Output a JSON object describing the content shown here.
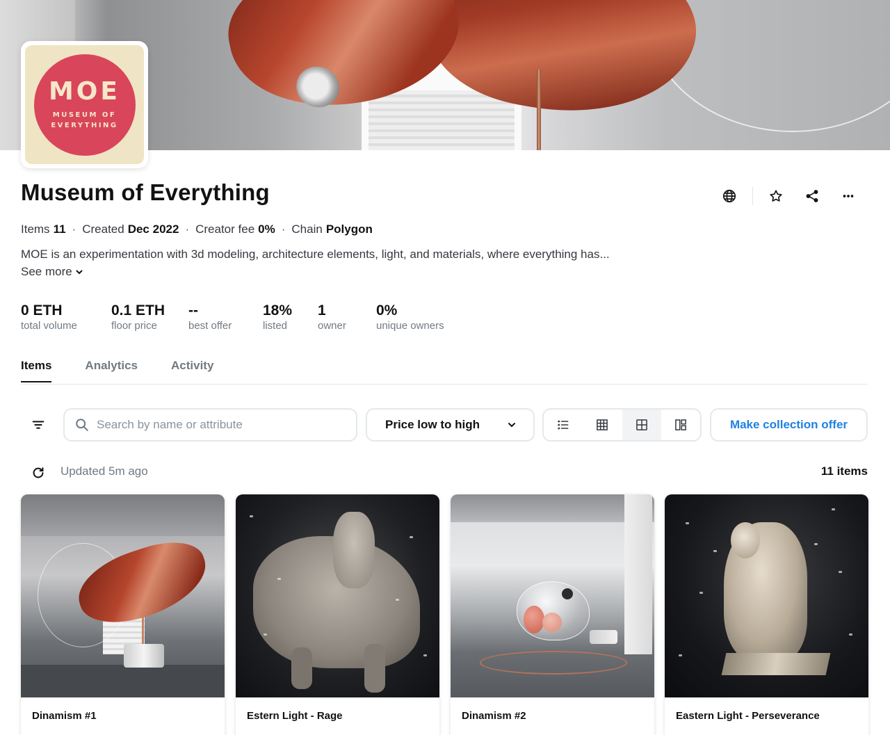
{
  "collection": {
    "logo": {
      "big": "MOE",
      "line1": "MUSEUM OF",
      "line2": "EVERYTHING"
    },
    "title": "Museum of Everything",
    "meta": {
      "items_label": "Items",
      "items_value": "11",
      "created_label": "Created",
      "created_value": "Dec 2022",
      "fee_label": "Creator fee",
      "fee_value": "0%",
      "chain_label": "Chain",
      "chain_value": "Polygon",
      "separator": "·"
    },
    "description": "MOE is an experimentation with 3d modeling, architecture elements, light, and materials, where everything has...",
    "see_more": "See more"
  },
  "actions": {
    "icons": [
      "globe-icon",
      "star-icon",
      "share-icon",
      "more-icon"
    ]
  },
  "stats": [
    {
      "value": "0 ETH",
      "label": "total volume"
    },
    {
      "value": "0.1 ETH",
      "label": "floor price"
    },
    {
      "value": "--",
      "label": "best offer"
    },
    {
      "value": "18%",
      "label": "listed"
    },
    {
      "value": "1",
      "label": "owner"
    },
    {
      "value": "0%",
      "label": "unique owners"
    }
  ],
  "tabs": [
    {
      "label": "Items",
      "active": true
    },
    {
      "label": "Analytics",
      "active": false
    },
    {
      "label": "Activity",
      "active": false
    }
  ],
  "toolbar": {
    "search_placeholder": "Search by name or attribute",
    "search_value": "",
    "sort_selected": "Price low to high",
    "views": [
      "list-view-icon",
      "grid-small-icon",
      "grid-large-icon",
      "gallery-icon"
    ],
    "active_view": 2,
    "offer_button": "Make collection offer"
  },
  "status": {
    "updated": "Updated 5m ago",
    "count": "11 items"
  },
  "items": [
    {
      "name": "Dinamism #1"
    },
    {
      "name": "Estern Light - Rage"
    },
    {
      "name": "Dinamism #2"
    },
    {
      "name": "Eastern Light - Perseverance"
    }
  ],
  "colors": {
    "accent": "#2081e2",
    "logo_circle": "#d9455a",
    "logo_bg": "#efe4c4",
    "text": "#121212",
    "muted": "#707a83"
  }
}
